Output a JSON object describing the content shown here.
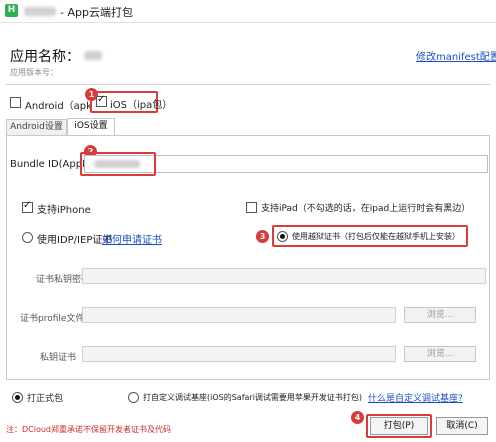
{
  "window": {
    "title": "- App云端打包",
    "logo_letter": "H"
  },
  "header": {
    "app_name_label": "应用名称：",
    "app_version_label": "应用版本号：",
    "manifest_link": "修改manifest配置"
  },
  "platforms": {
    "android_label": "Android（apk",
    "android_checked": false,
    "ios_label": "iOS（ipa包）",
    "ios_checked": true
  },
  "tabs": [
    {
      "label": "Android设置",
      "active": false
    },
    {
      "label": "iOS设置",
      "active": true
    }
  ],
  "ios_settings": {
    "bundle_id_label": "Bundle ID(AppID)",
    "bundle_id_value": "",
    "iphone_label": "支持iPhone",
    "iphone_checked": true,
    "ipad_label": "支持iPad（不勾选的话，在ipad上运行时会有黑边）",
    "ipad_checked": false,
    "cert_idp_label": "使用IDP/IEP证书",
    "cert_how_link": "如何申请证书",
    "cert_jailbreak_label": "使用越狱证书（打包后仅能在越狱手机上安装）",
    "cert_jailbreak_selected": true,
    "key_password_label": "证书私钥密码",
    "profile_label": "证书profile文件",
    "private_cert_label": "私钥证书",
    "browse_label": "浏览..."
  },
  "build_type": {
    "formal_label": "打正式包",
    "formal_selected": true,
    "custom_label": "打自定义调试基座(iOS的Safari调试需要用苹果开发证书打包)",
    "custom_selected": false,
    "custom_link": "什么是自定义调试基座?"
  },
  "footer": {
    "note": "注：DCloud郑重承诺不保留开发者证书及代码",
    "build_button": "打包(P)",
    "cancel_button": "取消(C)"
  },
  "badges": [
    "1",
    "2",
    "3",
    "4"
  ],
  "colors": {
    "highlight": "#d93a3a",
    "link": "#1a4fc4",
    "logo": "#2bb24c"
  }
}
